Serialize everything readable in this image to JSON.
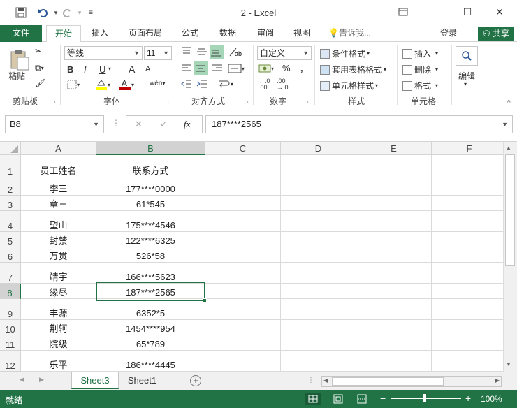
{
  "app": {
    "title": "2 - Excel"
  },
  "tabs": [
    "文件",
    "开始",
    "插入",
    "页面布局",
    "公式",
    "数据",
    "审阅",
    "视图"
  ],
  "tell_me": "告诉我...",
  "login": "登录",
  "share": "共享",
  "ribbon": {
    "clipboard": {
      "paste": "粘贴",
      "label": "剪贴板"
    },
    "font": {
      "name": "等线",
      "size": "11",
      "bold": "B",
      "italic": "I",
      "underline": "U",
      "grow": "A",
      "shrink": "A",
      "wen": "wén",
      "label": "字体"
    },
    "align": {
      "label": "对齐方式"
    },
    "number": {
      "format": "自定义",
      "label": "数字"
    },
    "styles": {
      "cond": "条件格式",
      "table": "套用表格格式",
      "cell": "单元格样式",
      "label": "样式"
    },
    "cells": {
      "insert": "插入",
      "delete": "删除",
      "format": "格式",
      "label": "单元格"
    },
    "edit": {
      "label": "编辑"
    }
  },
  "formula_bar": {
    "name_box": "B8",
    "fx": "fx",
    "value": "187****2565"
  },
  "columns": [
    "A",
    "B",
    "C",
    "D",
    "E",
    "F"
  ],
  "rows": [
    {
      "n": "1",
      "a": "员工姓名",
      "b": "联系方式"
    },
    {
      "n": "2",
      "a": "李三",
      "b": "177****0000"
    },
    {
      "n": "3",
      "a": "章三",
      "b": "61*545"
    },
    {
      "n": "4",
      "a": "望山",
      "b": "175****4546"
    },
    {
      "n": "5",
      "a": "封禁",
      "b": "122****6325"
    },
    {
      "n": "6",
      "a": "万贯",
      "b": "526*58"
    },
    {
      "n": "7",
      "a": "靖宇",
      "b": "166****5623"
    },
    {
      "n": "8",
      "a": "缘尽",
      "b": "187****2565"
    },
    {
      "n": "9",
      "a": "丰源",
      "b": "6352*5"
    },
    {
      "n": "10",
      "a": "荆轲",
      "b": "1454****954"
    },
    {
      "n": "11",
      "a": "院级",
      "b": "65*789"
    },
    {
      "n": "12",
      "a": "乐平",
      "b": "186****4445"
    }
  ],
  "sheets": [
    "Sheet3",
    "Sheet1"
  ],
  "status": {
    "ready": "就绪",
    "zoom": "100%"
  },
  "colors": {
    "accent": "#217346"
  }
}
